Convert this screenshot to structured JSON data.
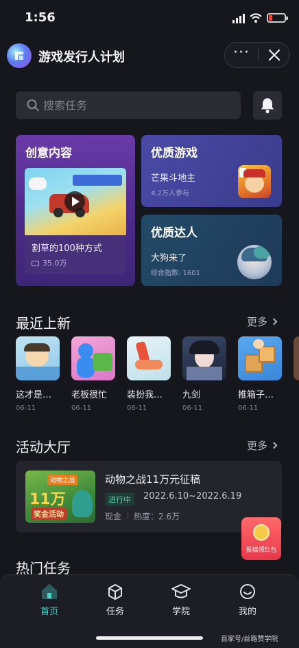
{
  "status_bar": {
    "time": "1:56"
  },
  "header": {
    "title": "游戏发行人计划",
    "more_label": "···"
  },
  "search": {
    "placeholder": "搜索任务"
  },
  "cards": {
    "creative": {
      "title": "创意内容",
      "video_caption": "割草的100种方式",
      "views": "35.0万"
    },
    "games": {
      "title": "优质游戏",
      "game_name": "芒果斗地主",
      "participants": "4.2万人参与"
    },
    "talent": {
      "title": "优质达人",
      "name": "大狗来了",
      "score": "综合指数: 1601"
    }
  },
  "recent": {
    "title": "最近上新",
    "more": "更多",
    "items": [
      {
        "name": "这才是…",
        "date": "06-11",
        "icon": "sleeping-boy-icon"
      },
      {
        "name": "老板很忙",
        "date": "06-11",
        "icon": "blue-man-money-icon"
      },
      {
        "name": "装扮我…",
        "date": "06-11",
        "icon": "shoe-icon"
      },
      {
        "name": "九剑",
        "date": "06-11",
        "icon": "swordswoman-icon"
      },
      {
        "name": "推箱子…",
        "date": "06-11",
        "icon": "boxes-icon"
      }
    ]
  },
  "activity_hall": {
    "title": "活动大厅",
    "more": "更多",
    "item": {
      "title": "动物之战11万元征稿",
      "status": "进行中",
      "dates": "2022.6.10~2022.6.19",
      "reward": "现金",
      "heat": "热度：2.6万",
      "image_big_text": "11万",
      "image_small_text": "奖金活动",
      "image_tag": "动物之战"
    }
  },
  "redpack": {
    "label": "投稿领红包"
  },
  "hot_tasks": {
    "title": "热门任务"
  },
  "tabs": [
    {
      "label": "首页",
      "icon": "home-icon",
      "active": true
    },
    {
      "label": "任务",
      "icon": "task-box-icon",
      "active": false
    },
    {
      "label": "学院",
      "icon": "graduation-cap-icon",
      "active": false
    },
    {
      "label": "我的",
      "icon": "smile-icon",
      "active": false
    }
  ],
  "watermark": "百家号/丝路赞学院",
  "colors": {
    "accent": "#4fd1c5",
    "background": "#16171d",
    "card": "#23242c",
    "badge_green": "#4fd1a5"
  }
}
